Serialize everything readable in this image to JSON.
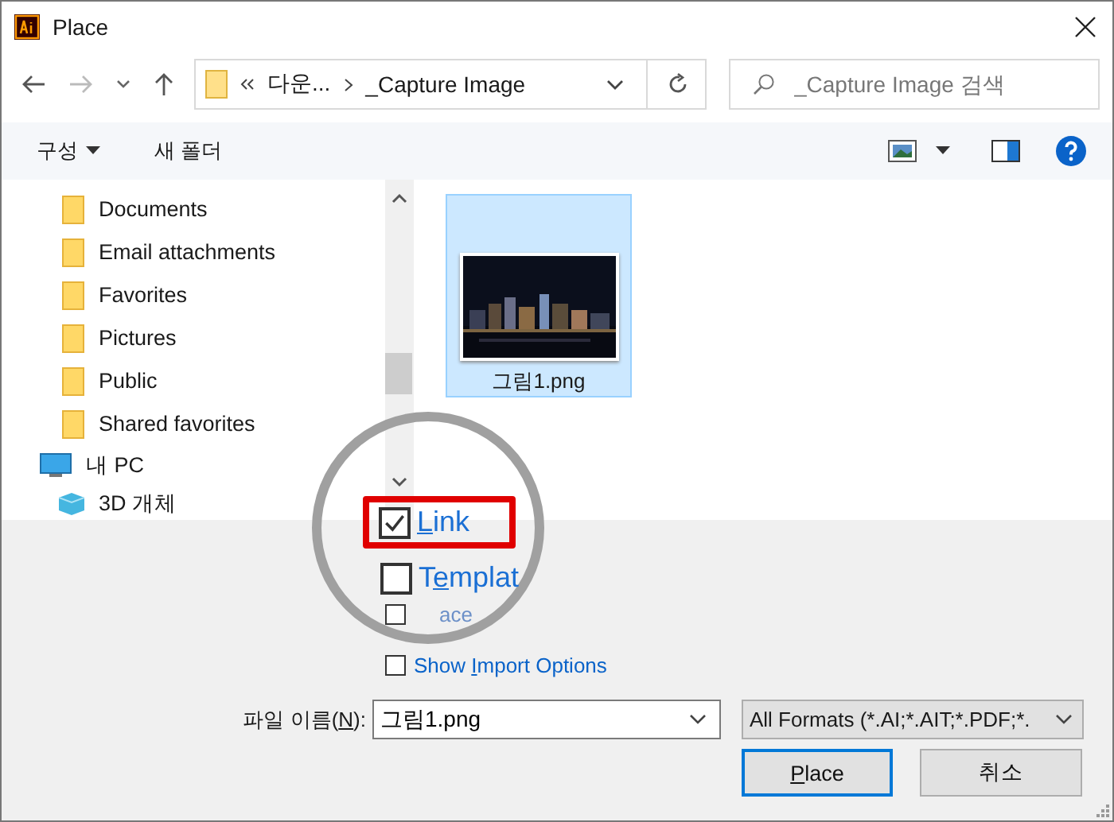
{
  "window": {
    "title": "Place"
  },
  "navigation": {
    "path": [
      {
        "label": "다운..."
      },
      {
        "label": "_Capture Image"
      }
    ],
    "search": {
      "placeholder": "_Capture Image 검색"
    }
  },
  "toolbar": {
    "organize": "구성",
    "new_folder": "새 폴더"
  },
  "sidebar": {
    "items": [
      {
        "label": "Documents",
        "kind": "folder"
      },
      {
        "label": "Email attachments",
        "kind": "folder"
      },
      {
        "label": "Favorites",
        "kind": "folder"
      },
      {
        "label": "Pictures",
        "kind": "folder"
      },
      {
        "label": "Public",
        "kind": "folder"
      },
      {
        "label": "Shared favorites",
        "kind": "folder"
      },
      {
        "label": "내 PC",
        "kind": "pc"
      },
      {
        "label": "3D 개체",
        "kind": "cube"
      }
    ]
  },
  "files": [
    {
      "name": "그림1.png",
      "selected": true,
      "kind": "picture"
    }
  ],
  "magnifier": {
    "options": [
      {
        "label": {
          "key": "L",
          "after": "ink"
        },
        "checked": true,
        "highlighted": true
      },
      {
        "label": {
          "before": "T",
          "key": "e",
          "after": "mplat"
        },
        "checked": false,
        "highlighted": false
      }
    ]
  },
  "options": [
    {
      "label": "ace",
      "checked": false
    },
    {
      "label": {
        "before": "Show ",
        "key": "I",
        "after": "mport Options"
      },
      "checked": false
    }
  ],
  "filename": {
    "label": {
      "before": "파일 이름(",
      "key": "N",
      "after": "):"
    },
    "value": "그림1.png"
  },
  "filter": {
    "value": "All Formats (*.AI;*.AIT;*.PDF;*."
  },
  "buttons": [
    {
      "label": {
        "key": "P",
        "after": "lace"
      },
      "default": true
    },
    {
      "label": "취소",
      "default": false
    }
  ]
}
